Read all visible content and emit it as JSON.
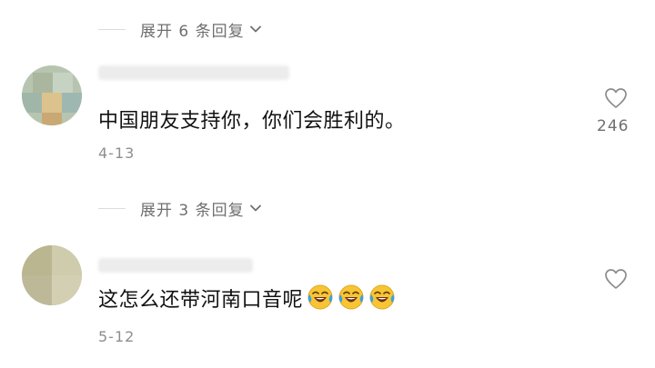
{
  "thread_top": {
    "expand_label": "展开 6 条回复"
  },
  "comments": [
    {
      "text": "中国朋友支持你，你们会胜利的。",
      "date": "4-13",
      "likes": "246"
    },
    {
      "text": "这怎么还带河南口音呢",
      "emoji": [
        "rofl-emoji",
        "rofl-emoji",
        "rofl-emoji"
      ],
      "date": "5-12",
      "likes": ""
    }
  ],
  "thread_middle": {
    "expand_label": "展开 3 条回复"
  },
  "icons": {
    "chevron": "chevron-down-icon",
    "like": "heart-outline-icon"
  },
  "colors": {
    "expand_text": "#6f6f6f",
    "date_text": "#8e8e8e",
    "comment_text": "#111111",
    "emoji_face": "#f7c533",
    "emoji_tear": "#3aa0e8"
  }
}
